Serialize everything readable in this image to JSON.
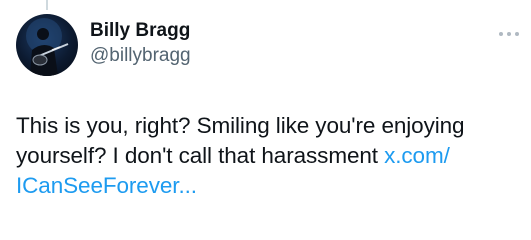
{
  "author": {
    "display_name": "Billy Bragg",
    "handle": "@billybragg",
    "avatar_icon": "profile-photo"
  },
  "more_menu": {
    "icon": "more-horizontal-icon"
  },
  "tweet": {
    "text": "This is you, right? Smiling like you're enjoying yourself? I don't call that harassment ",
    "link_text": "x.com/ICanSeeForever...",
    "link_line1": "x.com/",
    "link_line2": "ICanSeeForever..."
  },
  "colors": {
    "link": "#1d9bf0",
    "secondary_text": "#536471",
    "primary_text": "#0f1419",
    "thread_line": "#cfd9de"
  }
}
